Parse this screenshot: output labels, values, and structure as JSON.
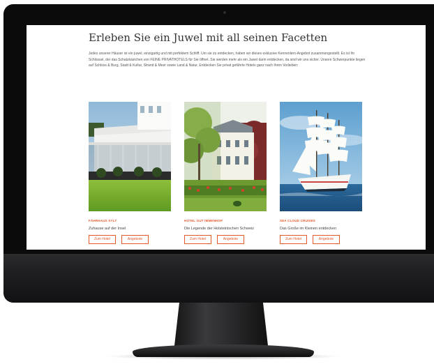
{
  "page": {
    "heading": "Erleben Sie ein Juwel mit all seinen Facetten",
    "intro": "Jedes unserer Häuser ist ein juwel, einzigartig und mit perfektem Schliff. Um sie zu entdecken, haben wir dieses exklusive Kennenlern-Angebot zusammengestellt. Es ist Ihr Schlüssel, der das Schatzkästchen von FEINE PRIVATHOTELS für Sie öffnet. Sie werden mehr als ein Juwel darin entdecken, da sind wir uns sicher. Unsere Schwerpunkte liegen auf Schloss & Burg, Stadt & Kultur, Strand & Meer sowie Land & Natur. Entdecken Sie privat geführte Hotels ganz nach Ihren Vorlieben:"
  },
  "cards": [
    {
      "title": "FÄHRHAUS SYLT",
      "subtitle": "Zuhause auf der Insel",
      "hotel_btn": "Zum Hotel",
      "offers_btn": "Angebote"
    },
    {
      "title": "HOTEL GUT IMMENHOF",
      "subtitle": "Die Legende der Holsteinischen Schweiz",
      "hotel_btn": "Zum Hotel",
      "offers_btn": "Angebote"
    },
    {
      "title": "SEA CLOUD CRUISES",
      "subtitle": "Das Große im Kleinen entdecken",
      "hotel_btn": "Zum Hotel",
      "offers_btn": "Angebote"
    }
  ],
  "colors": {
    "accent": "#e5582a",
    "monitor": "#0b0b0c"
  }
}
